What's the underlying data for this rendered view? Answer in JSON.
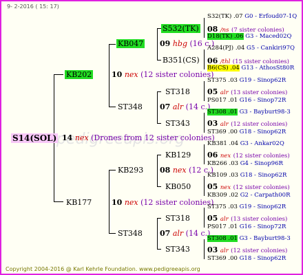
{
  "header": {
    "date": "9- 2-2016 ( 15: 17)"
  },
  "footer": {
    "copyright": "Copyright 2004-2016 @ Karl Kehrle Foundation.   www.pedigreeapis.org"
  },
  "watermark": {
    "text": "pedigreeapis.org"
  },
  "colors": {
    "border": "#e020e0",
    "highlight_green": "#22dd22",
    "highlight_yellow": "#ffff00",
    "highlight_pink": "#f8c8f8",
    "mark_red": "#cc0000",
    "sister_purple": "#7700aa",
    "location_blue": "#0000aa"
  },
  "root": {
    "name": "S14(SOL)",
    "year": "14",
    "mark": "nex",
    "note": "(Drones from 12 sister colonies)"
  },
  "dam": {
    "name": "KB202",
    "year": "10",
    "mark": "nex",
    "note": "(12 sister colonies)",
    "dam": {
      "name": "KB047",
      "year": "09",
      "mark": "hbg",
      "note": "(16 c.)",
      "dam": {
        "name": "S532(TK)",
        "year": "08",
        "mark": "/ns",
        "note": "(7 sister colonies)",
        "dam": {
          "name": "S32(TK) .07",
          "loc": "G0 - Erfoud07-1Q"
        },
        "sire": {
          "name": "D18(TK) .06",
          "loc": "G3 - Maced02Q"
        }
      },
      "sire": {
        "name": "B351(CS)",
        "year": "06",
        "mark": "/thl",
        "note": "(15 sister colonies)",
        "dam": {
          "name": "A284(PJ) .04",
          "loc": "G5 - Cankiri97Q"
        },
        "sire": {
          "name": "B6(CS) .04",
          "loc": "G13 - AthosSt80R"
        }
      }
    },
    "sire": {
      "name": "ST348",
      "year": "07",
      "mark": "alr",
      "note": "(14 c.)",
      "dam": {
        "name": "ST318",
        "year": "05",
        "mark": "alr",
        "note": "(13 sister colonies)",
        "dam": {
          "name": "ST375 .03",
          "loc": "G19 - Sinop62R"
        },
        "sire": {
          "name": "PS017 .01",
          "loc": "G16 - Sinop72R"
        }
      },
      "sire": {
        "name": "ST343",
        "year": "03",
        "mark": "alr",
        "note": "(12 sister colonies)",
        "dam": {
          "name": "ST308 .01",
          "loc": "G3 - Bayburt98-3"
        },
        "sire": {
          "name": "ST369 .00",
          "loc": "G18 - Sinop62R"
        }
      }
    }
  },
  "sire": {
    "name": "KB177",
    "year": "10",
    "mark": "nex",
    "note": "(12 sister colonies)",
    "dam": {
      "name": "KB293",
      "year": "08",
      "mark": "nex",
      "note": "(12 c.)",
      "dam": {
        "name": "KB129",
        "year": "06",
        "mark": "nex",
        "note": "(12 sister colonies)",
        "dam": {
          "name": "KB381 .04",
          "loc": "G3 - Ankar02Q"
        },
        "sire": {
          "name": "KB266 .03",
          "loc": "G4 - Sinop96R"
        }
      },
      "sire": {
        "name": "KB050",
        "year": "05",
        "mark": "nex",
        "note": "(12 sister colonies)",
        "dam": {
          "name": "KB109 .03",
          "loc": "G18 - Sinop62R"
        },
        "sire": {
          "name": "KB309 .02",
          "loc": "G2 - Carpath00R"
        }
      }
    },
    "sire": {
      "name": "ST348",
      "year": "07",
      "mark": "alr",
      "note": "(14 c.)",
      "dam": {
        "name": "ST318",
        "year": "05",
        "mark": "alr",
        "note": "(13 sister colonies)",
        "dam": {
          "name": "ST375 .03",
          "loc": "G19 - Sinop62R"
        },
        "sire": {
          "name": "PS017 .01",
          "loc": "G16 - Sinop72R"
        }
      },
      "sire": {
        "name": "ST343",
        "year": "03",
        "mark": "alr",
        "note": "(12 sister colonies)",
        "dam": {
          "name": "ST308 .01",
          "loc": "G3 - Bayburt98-3"
        },
        "sire": {
          "name": "ST369 .00",
          "loc": "G18 - Sinop62R"
        }
      }
    }
  }
}
